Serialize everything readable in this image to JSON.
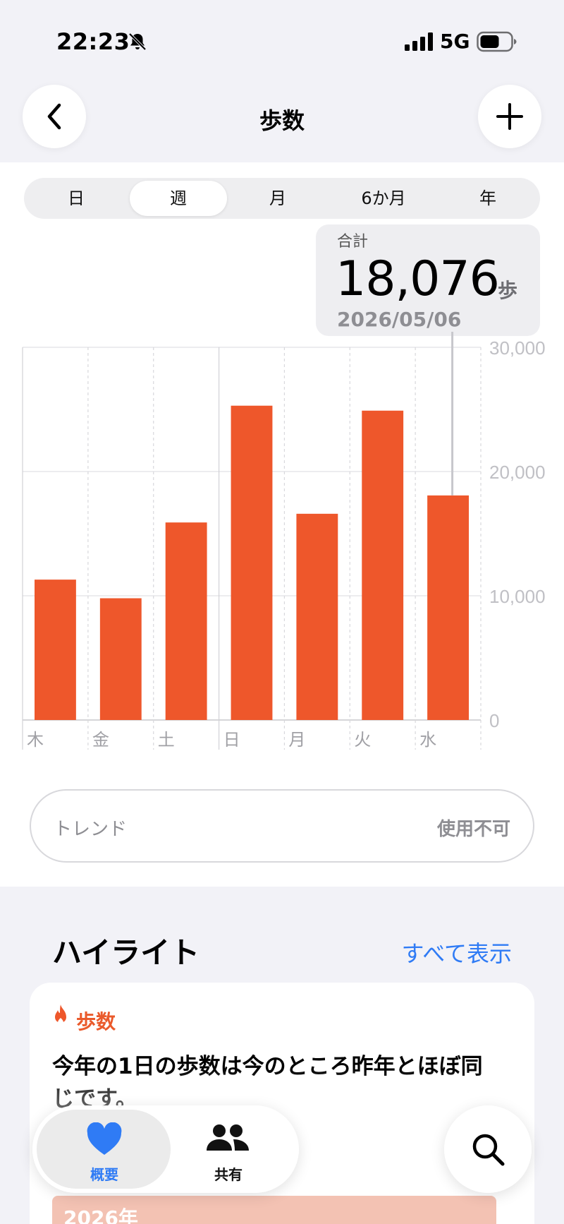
{
  "status_bar": {
    "time": "22:23",
    "network": "5G"
  },
  "nav": {
    "title": "歩数"
  },
  "segments": [
    {
      "label": "日",
      "active": false
    },
    {
      "label": "週",
      "active": true
    },
    {
      "label": "月",
      "active": false
    },
    {
      "label": "6か月",
      "active": false
    },
    {
      "label": "年",
      "active": false
    }
  ],
  "summary": {
    "label": "合計",
    "value": "18,076",
    "unit": "歩",
    "date": "2026/05/06"
  },
  "chart_data": {
    "type": "bar",
    "categories": [
      "木",
      "金",
      "土",
      "日",
      "月",
      "火",
      "水"
    ],
    "values": [
      11300,
      9800,
      15900,
      25300,
      16600,
      24900,
      18076
    ],
    "selected_index": 6,
    "ylim": [
      0,
      30000
    ],
    "yticks": [
      0,
      10000,
      20000,
      30000
    ],
    "ytick_labels": [
      "0",
      "10,000",
      "20,000",
      "30,000"
    ],
    "bar_color": "#ee572b",
    "grid": true,
    "title": "",
    "xlabel": "",
    "ylabel": ""
  },
  "trend": {
    "label": "トレンド",
    "value": "使用不可"
  },
  "highlights": {
    "title": "ハイライト",
    "show_all": "すべて表示",
    "card": {
      "category": "歩数",
      "text": "今年の1日の歩数は今のところ昨年とほぼ同じです。",
      "year": "2026年"
    }
  },
  "tabbar": {
    "tabs": [
      {
        "label": "概要",
        "active": true,
        "icon": "heart-icon"
      },
      {
        "label": "共有",
        "active": false,
        "icon": "people-icon"
      }
    ]
  },
  "colors": {
    "accent": "#ee572b",
    "link": "#2f7bf5",
    "tab_active": "#2f7bf5"
  }
}
